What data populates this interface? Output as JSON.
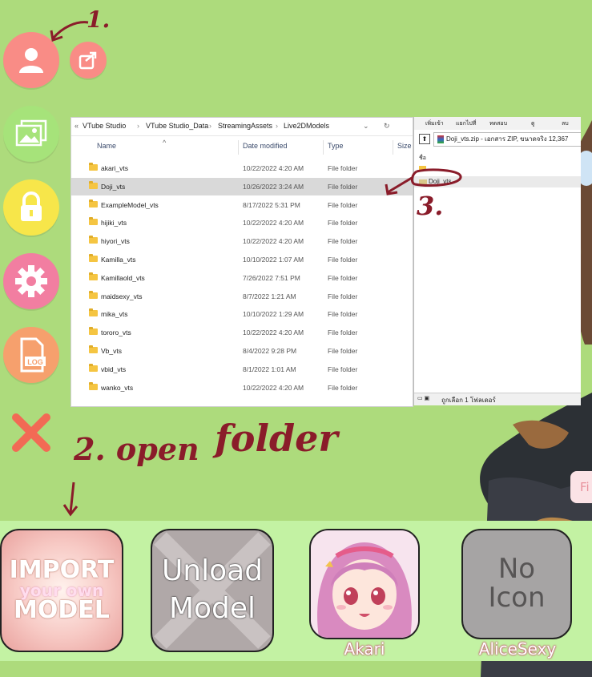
{
  "explorer": {
    "breadcrumb": [
      "VTube Studio",
      "VTube Studio_Data",
      "StreamingAssets",
      "Live2DModels"
    ],
    "columns": {
      "name": "Name",
      "date": "Date modified",
      "type": "Type",
      "size": "Size"
    },
    "rows": [
      {
        "name": "akari_vts",
        "date": "10/22/2022 4:20 AM",
        "type": "File folder"
      },
      {
        "name": "Doji_vts",
        "date": "10/26/2022 3:24 AM",
        "type": "File folder"
      },
      {
        "name": "ExampleModel_vts",
        "date": "8/17/2022 5:31 PM",
        "type": "File folder"
      },
      {
        "name": "hijiki_vts",
        "date": "10/22/2022 4:20 AM",
        "type": "File folder"
      },
      {
        "name": "hiyori_vts",
        "date": "10/22/2022 4:20 AM",
        "type": "File folder"
      },
      {
        "name": "Kamilla_vts",
        "date": "10/10/2022 1:07 AM",
        "type": "File folder"
      },
      {
        "name": "Kamillaold_vts",
        "date": "7/26/2022 7:51 PM",
        "type": "File folder"
      },
      {
        "name": "maidsexy_vts",
        "date": "8/7/2022 1:21 AM",
        "type": "File folder"
      },
      {
        "name": "mika_vts",
        "date": "10/10/2022 1:29 AM",
        "type": "File folder"
      },
      {
        "name": "tororo_vts",
        "date": "10/22/2022 4:20 AM",
        "type": "File folder"
      },
      {
        "name": "Vb_vts",
        "date": "8/4/2022 9:28 PM",
        "type": "File folder"
      },
      {
        "name": "vbid_vts",
        "date": "8/1/2022 1:01 AM",
        "type": "File folder"
      },
      {
        "name": "wanko_vts",
        "date": "10/22/2022 4:20 AM",
        "type": "File folder"
      }
    ]
  },
  "rar": {
    "toolbar": [
      "เพิ่มเข้า",
      "แยกไปที่",
      "ทดสอบ",
      "ดู",
      "ลบ"
    ],
    "path": "Doji_vts.zip - เอกสาร ZIP, ขนาดจริง 12,367",
    "header_name": "ชื่อ",
    "item": "Doji_vts",
    "status": "ถูกเลือก 1 โฟลเดอร์"
  },
  "annotations": {
    "step1": "1.",
    "step2": "2. open",
    "folder": "folder",
    "step3": "3."
  },
  "tiles": [
    {
      "line1": "IMPORT",
      "line2": "your own",
      "line3": "MODEL"
    },
    {
      "line1": "Unload",
      "line2": "Model"
    },
    {
      "label": "Akari"
    },
    {
      "line1": "No",
      "line2": "Icon",
      "label": "AliceSexy"
    }
  ],
  "side_label": "LOG",
  "partial_text": "Fi",
  "colors": {
    "bg": "#addb7c",
    "tile_strip": "#c3f2a3",
    "salmon": "#f98c86",
    "green": "#a6e37a",
    "yellow": "#f7e64a",
    "pink": "#f27ea1",
    "orange": "#f6a06d",
    "close": "#f26a55",
    "ink": "#8a1c2a"
  }
}
